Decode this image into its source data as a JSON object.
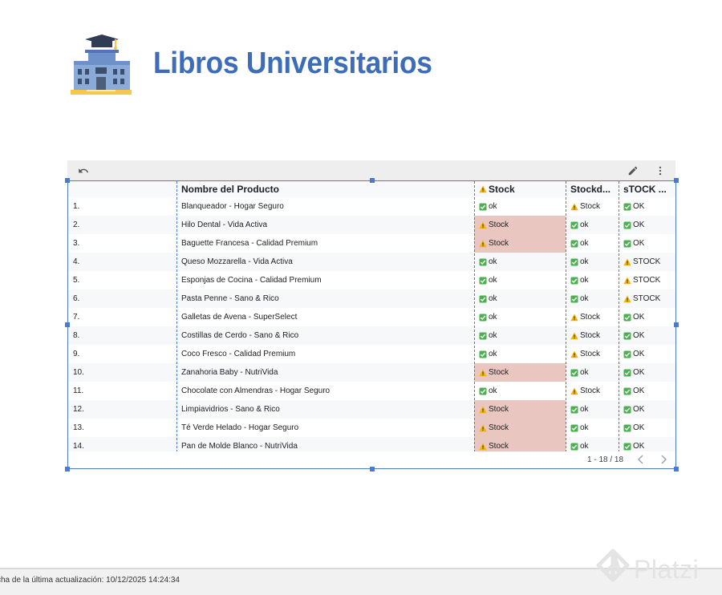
{
  "header": {
    "title": "Libros Universitarios"
  },
  "colors": {
    "title": "#3d6db8",
    "selection": "#4a7bd0",
    "bad_cell": "#e9c6c0",
    "check": "#34a853",
    "warn": "#f5b400"
  },
  "toolbar": {
    "undo_icon": "undo-icon",
    "edit_icon": "pencil-icon",
    "more_icon": "more-vert-icon"
  },
  "table": {
    "columns": [
      "",
      "Nombre del Producto",
      "Stock",
      "Stockd...",
      "sTOCK ..."
    ],
    "rows": [
      {
        "n": "1.",
        "name": "Blanqueador - Hogar Seguro",
        "s1": "ok",
        "s2": "Stock",
        "s3": "OK"
      },
      {
        "n": "2.",
        "name": "Hilo Dental - Vida Activa",
        "s1": "Stock",
        "s2": "ok",
        "s3": "OK"
      },
      {
        "n": "3.",
        "name": "Baguette Francesa - Calidad Premium",
        "s1": "Stock",
        "s2": "ok",
        "s3": "OK"
      },
      {
        "n": "4.",
        "name": "Queso Mozzarella - Vida Activa",
        "s1": "ok",
        "s2": "ok",
        "s3": "STOCK"
      },
      {
        "n": "5.",
        "name": "Esponjas de Cocina - Calidad Premium",
        "s1": "ok",
        "s2": "ok",
        "s3": "STOCK"
      },
      {
        "n": "6.",
        "name": "Pasta Penne - Sano & Rico",
        "s1": "ok",
        "s2": "ok",
        "s3": "STOCK"
      },
      {
        "n": "7.",
        "name": "Galletas de Avena - SuperSelect",
        "s1": "ok",
        "s2": "Stock",
        "s3": "OK"
      },
      {
        "n": "8.",
        "name": "Costillas de Cerdo - Sano & Rico",
        "s1": "ok",
        "s2": "Stock",
        "s3": "OK"
      },
      {
        "n": "9.",
        "name": "Coco Fresco - Calidad Premium",
        "s1": "ok",
        "s2": "Stock",
        "s3": "OK"
      },
      {
        "n": "10.",
        "name": "Zanahoria Baby - NutriVida",
        "s1": "Stock",
        "s2": "ok",
        "s3": "OK"
      },
      {
        "n": "11.",
        "name": "Chocolate con Almendras - Hogar Seguro",
        "s1": "ok",
        "s2": "Stock",
        "s3": "OK"
      },
      {
        "n": "12.",
        "name": "Limpiavidrios - Sano & Rico",
        "s1": "Stock",
        "s2": "ok",
        "s3": "OK"
      },
      {
        "n": "13.",
        "name": "Té Verde Helado - Hogar Seguro",
        "s1": "Stock",
        "s2": "ok",
        "s3": "OK"
      },
      {
        "n": "14.",
        "name": "Pan de Molde Blanco - NutriVida",
        "s1": "Stock",
        "s2": "ok",
        "s3": "OK"
      }
    ]
  },
  "pager": {
    "text": "1 - 18 / 18"
  },
  "status": {
    "text": "cha de la última actualización: 10/12/2025 14:24:34"
  },
  "watermark": {
    "text": "Platzi"
  }
}
